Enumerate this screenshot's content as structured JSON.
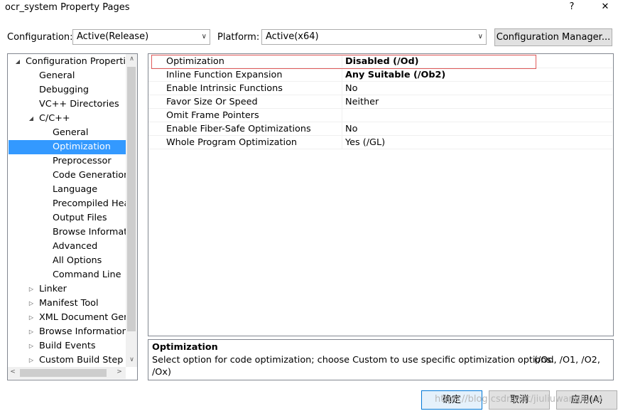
{
  "window": {
    "title": "ocr_system Property Pages",
    "help": "?",
    "close": "✕"
  },
  "toolbar": {
    "configuration_label": "Configuration:",
    "configuration_value": "Active(Release)",
    "platform_label": "Platform:",
    "platform_value": "Active(x64)",
    "config_manager_label": "Configuration Manager..."
  },
  "tree": {
    "items": [
      {
        "label": "Configuration Properties",
        "expander": "◢"
      },
      {
        "label": "General"
      },
      {
        "label": "Debugging"
      },
      {
        "label": "VC++ Directories"
      },
      {
        "label": "C/C++",
        "expander": "◢"
      },
      {
        "label": "General"
      },
      {
        "label": "Optimization"
      },
      {
        "label": "Preprocessor"
      },
      {
        "label": "Code Generation"
      },
      {
        "label": "Language"
      },
      {
        "label": "Precompiled Head"
      },
      {
        "label": "Output Files"
      },
      {
        "label": "Browse Informatic"
      },
      {
        "label": "Advanced"
      },
      {
        "label": "All Options"
      },
      {
        "label": "Command Line"
      },
      {
        "label": "Linker",
        "expander": "▷"
      },
      {
        "label": "Manifest Tool",
        "expander": "▷"
      },
      {
        "label": "XML Document Gene",
        "expander": "▷"
      },
      {
        "label": "Browse Information",
        "expander": "▷"
      },
      {
        "label": "Build Events",
        "expander": "▷"
      },
      {
        "label": "Custom Build Step",
        "expander": "▷"
      }
    ]
  },
  "grid": {
    "rows": [
      {
        "name": "Optimization",
        "value": "Disabled (/Od)"
      },
      {
        "name": "Inline Function Expansion",
        "value": "Any Suitable (/Ob2)"
      },
      {
        "name": "Enable Intrinsic Functions",
        "value": "No"
      },
      {
        "name": "Favor Size Or Speed",
        "value": "Neither"
      },
      {
        "name": "Omit Frame Pointers",
        "value": ""
      },
      {
        "name": "Enable Fiber-Safe Optimizations",
        "value": "No"
      },
      {
        "name": "Whole Program Optimization",
        "value": "Yes (/GL)"
      }
    ]
  },
  "description": {
    "title": "Optimization",
    "text_line1": "Select option for code optimization; choose Custom to use specific optimization options.",
    "options_line1": "(/Od, /O1, /O2,",
    "text_line2": "/Ox)"
  },
  "footer": {
    "ok_label": "确定",
    "cancel_label": "取消",
    "apply_label": "应用(A)",
    "watermark": "https://blog.csdn.net/jiuliuwangliyue"
  },
  "colors": {
    "selection": "#3399ff",
    "highlight_border": "#e05a5a"
  }
}
